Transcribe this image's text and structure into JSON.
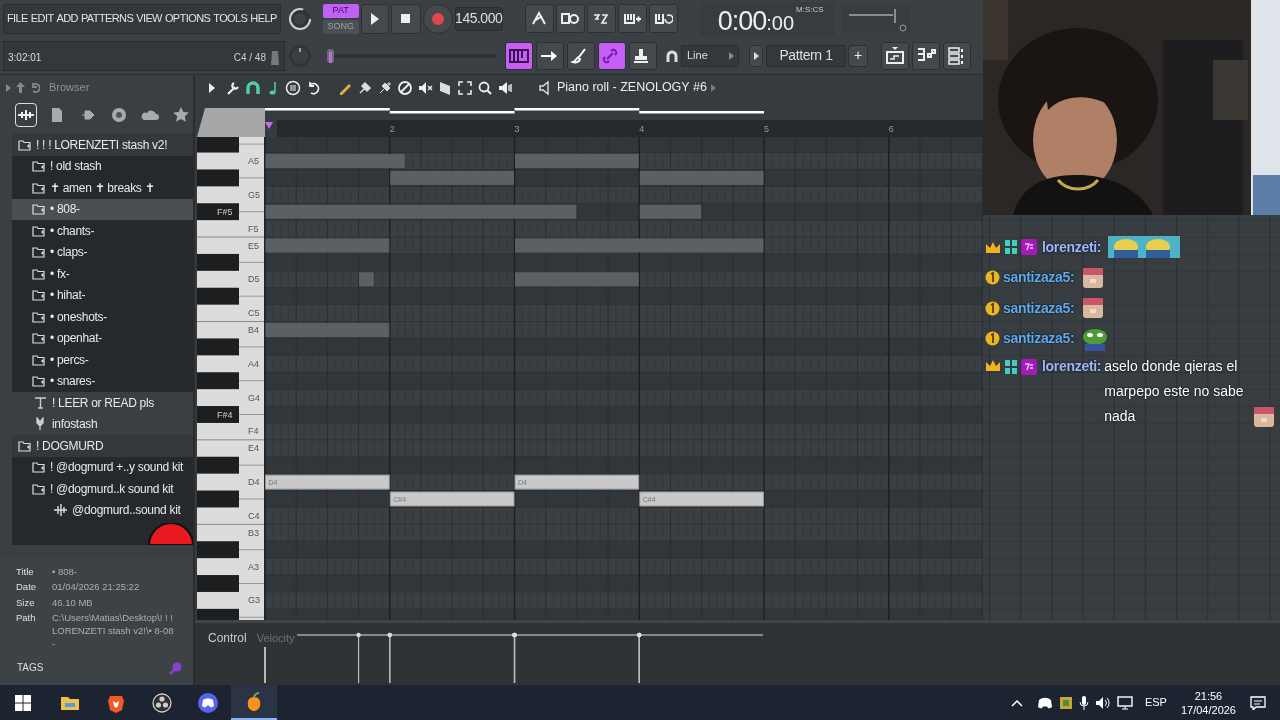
{
  "menu": [
    "FILE",
    "EDIT",
    "ADD",
    "PATTERNS",
    "VIEW",
    "OPTIONS",
    "TOOLS",
    "HELP"
  ],
  "transport": {
    "modes": [
      {
        "label": "PAT",
        "selected": true
      },
      {
        "label": "SONG",
        "selected": false
      }
    ],
    "tempo": "145.000",
    "time": "0:00",
    "time_cs": ":00",
    "time_unit": "M:S:CS"
  },
  "hint_bar": {
    "position": "3:02:01",
    "note": "C4 / 48"
  },
  "pitch_slider": {
    "level": 0
  },
  "tool_buttons": [
    {
      "kind": "piano",
      "on": true
    },
    {
      "kind": "arrow",
      "on": false
    },
    {
      "kind": "brush",
      "on": false
    },
    {
      "kind": "link",
      "on": true
    },
    {
      "kind": "stamp",
      "on": false
    }
  ],
  "snap": "Line",
  "pattern": "Pattern 1",
  "pattern_add": "+",
  "browser": {
    "title": "Browser",
    "tabs": [
      {
        "kind": "all",
        "selected": true
      },
      {
        "kind": "files",
        "selected": false
      },
      {
        "kind": "plugins",
        "selected": false
      },
      {
        "kind": "online",
        "selected": false
      },
      {
        "kind": "cloud",
        "selected": false
      },
      {
        "kind": "favorites",
        "selected": false
      }
    ],
    "tree": [
      {
        "label": "! ! ! LORENZETI stash v2!",
        "kind": "folder",
        "selected": false,
        "children": [
          {
            "label": "! old stash",
            "kind": "folder",
            "selected": false
          },
          {
            "label": "✝ amen ✝ breaks ✝",
            "kind": "folder",
            "selected": false
          },
          {
            "label": "• 808-",
            "kind": "folder",
            "selected": true
          },
          {
            "label": "• chants-",
            "kind": "folder",
            "selected": false
          },
          {
            "label": "• claps-",
            "kind": "folder",
            "selected": false
          },
          {
            "label": "• fx-",
            "kind": "folder",
            "selected": false
          },
          {
            "label": "• hihat-",
            "kind": "folder",
            "selected": false
          },
          {
            "label": "• oneshots-",
            "kind": "folder",
            "selected": false
          },
          {
            "label": "• openhat-",
            "kind": "folder",
            "selected": false
          },
          {
            "label": "• percs-",
            "kind": "folder",
            "selected": false
          },
          {
            "label": "• snares-",
            "kind": "folder",
            "selected": false
          }
        ]
      },
      {
        "label": "! LEER or READ pls",
        "kind": "text",
        "selected": false
      },
      {
        "label": "infostash",
        "kind": "link",
        "selected": false
      },
      {
        "label": "! DOGMURD",
        "kind": "folder",
        "selected": false,
        "children": [
          {
            "label": "! @dogmurd +..y sound kit",
            "kind": "folder",
            "selected": false
          },
          {
            "label": "! @dogmurd..k sound kit",
            "kind": "folder",
            "selected": false,
            "children": [
              {
                "label": "@dogmurd..sound kit",
                "kind": "audio",
                "selected": false
              }
            ]
          }
        ]
      }
    ],
    "info": [
      {
        "label": "Title",
        "value": "• 808-"
      },
      {
        "label": "Date",
        "value": "01/04/2026 21:25:22"
      },
      {
        "label": "Size",
        "value": "46.10 MB"
      },
      {
        "label": "Path",
        "value": "C:\\Users\\Matias\\Desktop\\! ! ! LORENZETI stash v2!\\• 8-08-"
      }
    ],
    "tags": "TAGS"
  },
  "piano_roll": {
    "title": "Piano roll - ZENOLOGY #6",
    "bar_numbers": [
      "2",
      "3",
      "4",
      "5",
      "6"
    ],
    "keys": [
      {
        "kind": "black"
      },
      {
        "kind": "white",
        "label": "A5",
        "marked": false
      },
      {
        "kind": "black"
      },
      {
        "kind": "white",
        "label": "G5",
        "marked": false
      },
      {
        "kind": "black",
        "label": "F#5",
        "marked": true
      },
      {
        "kind": "white",
        "label": "F5",
        "marked": false
      },
      {
        "kind": "white",
        "label": "E5",
        "marked": false
      },
      {
        "kind": "black"
      },
      {
        "kind": "white",
        "label": "D5",
        "marked": false
      },
      {
        "kind": "black"
      },
      {
        "kind": "white",
        "label": "C5",
        "marked": false
      },
      {
        "kind": "white",
        "label": "B4",
        "marked": false
      },
      {
        "kind": "black"
      },
      {
        "kind": "white",
        "label": "A4",
        "marked": false
      },
      {
        "kind": "black"
      },
      {
        "kind": "white",
        "label": "G4",
        "marked": false
      },
      {
        "kind": "black",
        "label": "F#4",
        "marked": true
      },
      {
        "kind": "white",
        "label": "F4",
        "marked": false
      },
      {
        "kind": "white",
        "label": "E4",
        "marked": false
      },
      {
        "kind": "black"
      },
      {
        "kind": "white",
        "label": "D4",
        "marked": false
      },
      {
        "kind": "black"
      },
      {
        "kind": "white",
        "label": "C4",
        "marked": false
      },
      {
        "kind": "white",
        "label": "B3",
        "marked": false
      },
      {
        "kind": "black"
      },
      {
        "kind": "white",
        "label": "A3",
        "marked": false
      },
      {
        "kind": "black"
      },
      {
        "kind": "white",
        "label": "G3",
        "marked": false
      },
      {
        "kind": "black"
      }
    ],
    "notes": [
      {
        "label": "D4"
      },
      {
        "label": "C#4"
      },
      {
        "label": "D4"
      },
      {
        "label": "C#4"
      }
    ],
    "control": "Control",
    "lane": "Velocity"
  },
  "chat": [
    {
      "kind": "vip",
      "user": "lorenzeti:",
      "color": "#9db7ff",
      "emotes": [
        {
          "kind": "wide"
        }
      ]
    },
    {
      "kind": "founder",
      "user": "santizaza5:",
      "color": "#5ea9ef",
      "emotes": [
        {
          "kind": "cat"
        }
      ]
    },
    {
      "kind": "founder",
      "user": "santizaza5:",
      "color": "#5ea9ef",
      "emotes": [
        {
          "kind": "cat"
        }
      ]
    },
    {
      "kind": "founder",
      "user": "santizaza5:",
      "color": "#5ea9ef",
      "emotes": [
        {
          "kind": "frog"
        }
      ]
    },
    {
      "kind": "vip",
      "user": "lorenzeti:",
      "color": "#9db7ff",
      "text": "aselo donde qieras el marpepo este no sabe nada",
      "emotes": [
        {
          "kind": "cat"
        }
      ]
    }
  ],
  "taskbar": {
    "apps": [
      {
        "kind": "explorer",
        "selected": false
      },
      {
        "kind": "brave",
        "selected": false
      },
      {
        "kind": "obs",
        "selected": false
      },
      {
        "kind": "discord",
        "selected": false
      },
      {
        "kind": "fl",
        "selected": true
      }
    ],
    "lang": "ESP",
    "time": "21:56",
    "date": "17/04/2026"
  }
}
